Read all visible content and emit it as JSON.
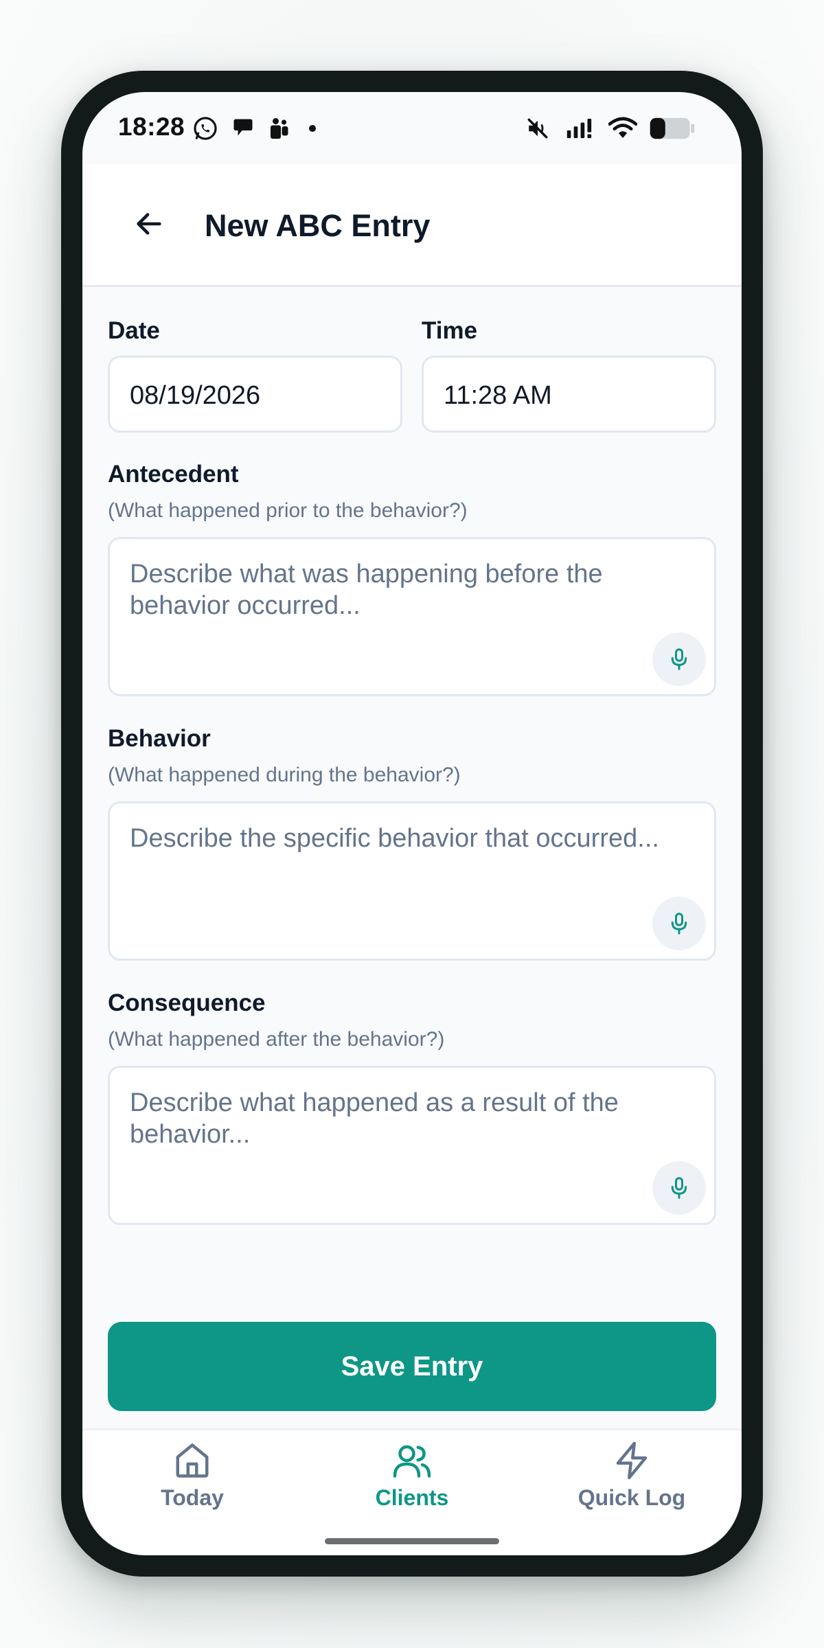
{
  "status_bar": {
    "time": "18:28"
  },
  "header": {
    "title": "New ABC Entry",
    "back_icon": "arrow-left-icon"
  },
  "form": {
    "date": {
      "label": "Date",
      "value": "08/19/2026"
    },
    "time": {
      "label": "Time",
      "value": "11:28 AM"
    },
    "antecedent": {
      "label": "Antecedent",
      "hint": "(What happened prior to the behavior?)",
      "placeholder": "Describe what was happening before the behavior occurred..."
    },
    "behavior": {
      "label": "Behavior",
      "hint": "(What happened during the behavior?)",
      "placeholder": "Describe the specific behavior that occurred..."
    },
    "consequence": {
      "label": "Consequence",
      "hint": "(What happened after the behavior?)",
      "placeholder": "Describe what happened as a result of the behavior..."
    },
    "save_label": "Save Entry"
  },
  "bottom_nav": {
    "items": [
      {
        "label": "Today",
        "icon": "home-icon",
        "active": false
      },
      {
        "label": "Clients",
        "icon": "users-icon",
        "active": true
      },
      {
        "label": "Quick Log",
        "icon": "lightning-icon",
        "active": false
      }
    ]
  },
  "colors": {
    "accent": "#0e9686",
    "text_primary": "#0f1a2a",
    "text_muted": "#64748b",
    "border": "#e2e8f0"
  }
}
